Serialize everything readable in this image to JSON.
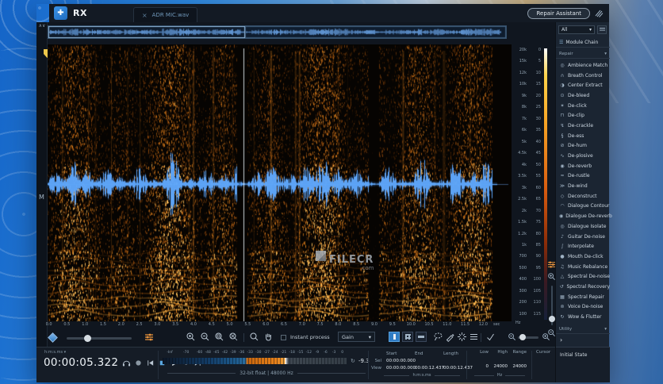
{
  "window": {
    "brand": "RX",
    "logo_glyph": "✚",
    "tab_close": "×",
    "tab_label": "ADR MIC.wav",
    "repair_assistant": "Repair Assistant"
  },
  "rail": {
    "collapse_glyph": "∧∨",
    "channel_label": "M"
  },
  "rulers": {
    "time_ticks": [
      "0.0",
      "0.5",
      "1.0",
      "1.5",
      "2.0",
      "2.5",
      "3.0",
      "3.5",
      "4.0",
      "4.5",
      "5.0",
      "5.5",
      "6.0",
      "6.5",
      "7.0",
      "7.5",
      "8.0",
      "8.5",
      "9.0",
      "9.5",
      "10.0",
      "10.5",
      "11.0",
      "11.5",
      "12.0"
    ],
    "time_unit": "sec",
    "freq_labels": [
      "20k",
      "15k",
      "12k",
      "10k",
      "9k",
      "8k",
      "7k",
      "6k",
      "5k",
      "4.5k",
      "4k",
      "3.5k",
      "3k",
      "2.5k",
      "2k",
      "1.5k",
      "1.2k",
      "1k",
      "700",
      "500",
      "400",
      "300",
      "200",
      "100"
    ],
    "freq_unit": "Hz",
    "legend_labels": [
      "0",
      "5",
      "10",
      "15",
      "20",
      "25",
      "30",
      "35",
      "40",
      "45",
      "50",
      "55",
      "60",
      "65",
      "70",
      "75",
      "80",
      "85",
      "90",
      "95",
      "100",
      "105",
      "110",
      "115"
    ]
  },
  "toolbar": {
    "instant_process": "Instant process",
    "preset": "Gain",
    "preset_chevron": "▾"
  },
  "transport": {
    "format_label": "h:m:s.ms ▾",
    "time": "00:00:05.322"
  },
  "meter": {
    "scale": [
      "-Inf",
      "-70",
      "-60",
      "-48",
      "-45",
      "-42",
      "-39",
      "-36",
      "-33",
      "-30",
      "-27",
      "-24",
      "-21",
      "-18",
      "-15",
      "-12",
      "-9",
      "-6",
      "-3",
      "0"
    ],
    "reset_glyph": "↻",
    "readout": "-9.3",
    "format_info": "32-bit float | 48000 Hz"
  },
  "selection": {
    "col_headers": [
      "Start",
      "End",
      "Length"
    ],
    "rows": [
      {
        "label": "Sel",
        "start": "00:00:00.000",
        "end": "",
        "length": ""
      },
      {
        "label": "View",
        "start": "00:00:00.000",
        "end": "00:00:12.437",
        "length": "00:00:12.437"
      }
    ],
    "unit": "h:m:s.ms"
  },
  "freq_selection": {
    "headers": [
      "Low",
      "High",
      "Range"
    ],
    "values": [
      "0",
      "24000",
      "24000"
    ],
    "unit": "Hz"
  },
  "cursor": {
    "header": "Cursor"
  },
  "panel": {
    "filter": "All",
    "filter_chevron": "▾",
    "module_chain": "Module Chain",
    "chain_icon_glyph": "☰",
    "sections": {
      "repair": "Repair",
      "utility": "Utility",
      "chevron": "▾"
    },
    "expand_arrow": "›",
    "modules": [
      {
        "icon": "◎",
        "label": "Ambience Match"
      },
      {
        "icon": "∩",
        "label": "Breath Control"
      },
      {
        "icon": "◑",
        "label": "Center Extract"
      },
      {
        "icon": "⊙",
        "label": "De-bleed"
      },
      {
        "icon": "✶",
        "label": "De-click"
      },
      {
        "icon": "⊓",
        "label": "De-clip"
      },
      {
        "icon": "↯",
        "label": "De-crackle"
      },
      {
        "icon": "§",
        "label": "De-ess"
      },
      {
        "icon": "⊘",
        "label": "De-hum"
      },
      {
        "icon": "∿",
        "label": "De-plosive"
      },
      {
        "icon": "◉",
        "label": "De-reverb"
      },
      {
        "icon": "≈",
        "label": "De-rustle"
      },
      {
        "icon": "≫",
        "label": "De-wind"
      },
      {
        "icon": "◇",
        "label": "Deconstruct"
      },
      {
        "icon": "◠",
        "label": "Dialogue Contour"
      },
      {
        "icon": "◉",
        "label": "Dialogue De-reverb"
      },
      {
        "icon": "◎",
        "label": "Dialogue Isolate"
      },
      {
        "icon": "♪",
        "label": "Guitar De-noise"
      },
      {
        "icon": "∫",
        "label": "Interpolate"
      },
      {
        "icon": "●",
        "label": "Mouth De-click"
      },
      {
        "icon": "♫",
        "label": "Music Rebalance"
      },
      {
        "icon": "△",
        "label": "Spectral De-noise"
      },
      {
        "icon": "↺",
        "label": "Spectral Recovery"
      },
      {
        "icon": "▦",
        "label": "Spectral Repair"
      },
      {
        "icon": "⊚",
        "label": "Voice De-noise"
      },
      {
        "icon": "↻",
        "label": "Wow & Flutter"
      }
    ],
    "history_entry": "Initial State"
  },
  "watermark": {
    "brand": "FILECR",
    "domain": ".com"
  },
  "colors": {
    "accent_blue": "#2f7cc4",
    "spectrogram_orange": "#e8821a",
    "waveform_blue": "#5aa7ff",
    "marker_yellow": "#ecc64a",
    "panel_bg": "#1b2532"
  }
}
